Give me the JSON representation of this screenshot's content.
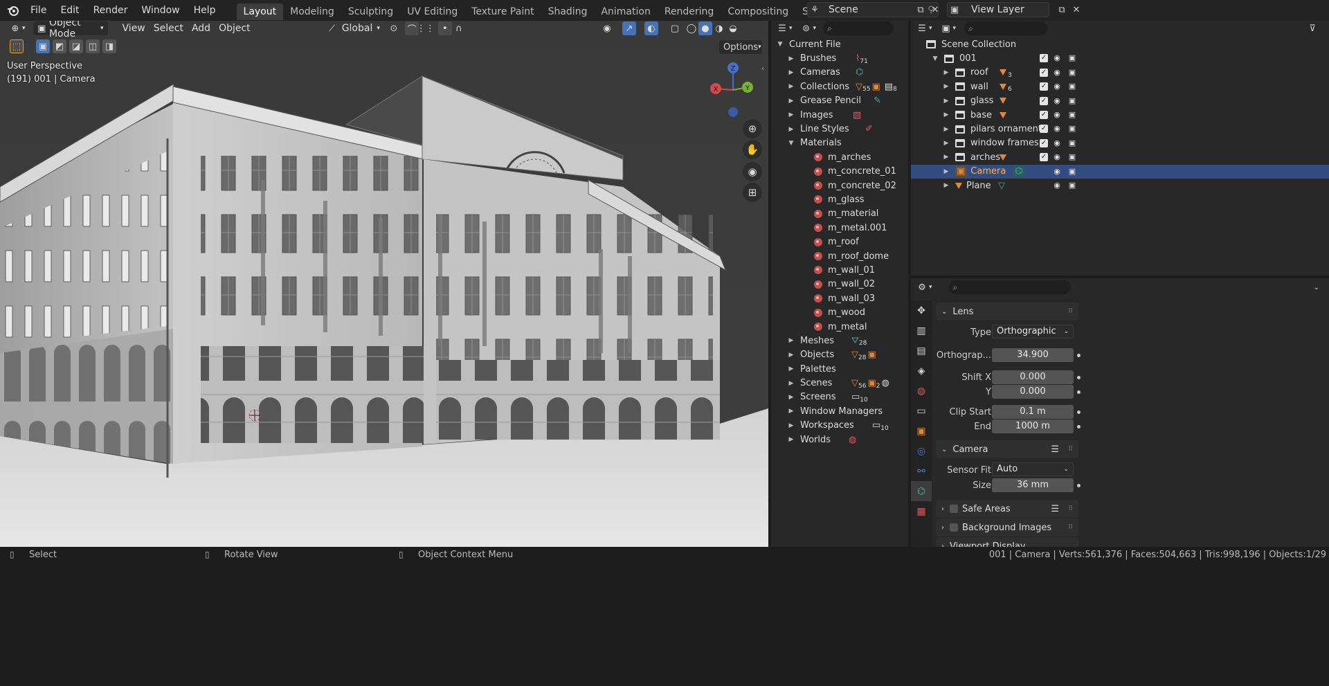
{
  "topbar": {
    "menus": [
      "File",
      "Edit",
      "Render",
      "Window",
      "Help"
    ],
    "workspaces": [
      "Layout",
      "Modeling",
      "Sculpting",
      "UV Editing",
      "Texture Paint",
      "Shading",
      "Animation",
      "Rendering",
      "Compositing",
      "Scripting"
    ],
    "active_workspace": "Layout",
    "scene_name": "Scene",
    "view_layer": "View Layer"
  },
  "viewport": {
    "mode": "Object Mode",
    "menus": [
      "View",
      "Select",
      "Add",
      "Object"
    ],
    "orientation": "Global",
    "options_label": "Options",
    "overlay_title": "User Perspective",
    "overlay_subtitle": "(191) 001 | Camera",
    "gizmo": {
      "z": "Z",
      "y": "Y",
      "x": "X"
    }
  },
  "data_outliner": {
    "root": "Current File",
    "items": [
      {
        "label": "Brushes",
        "count": "71"
      },
      {
        "label": "Cameras",
        "count": ""
      },
      {
        "label": "Collections",
        "count": "55",
        "count2": "8"
      },
      {
        "label": "Grease Pencil",
        "count": ""
      },
      {
        "label": "Images",
        "count": ""
      },
      {
        "label": "Line Styles",
        "count": ""
      },
      {
        "label": "Materials",
        "count": ""
      }
    ],
    "materials": [
      "m_arches",
      "m_concrete_01",
      "m_concrete_02",
      "m_glass",
      "m_material",
      "m_metal.001",
      "m_roof",
      "m_roof_dome",
      "m_wall_01",
      "m_wall_02",
      "m_wall_03",
      "m_wood",
      "m_metal"
    ],
    "items_after": [
      {
        "label": "Meshes",
        "count": "28"
      },
      {
        "label": "Objects",
        "count": "28"
      },
      {
        "label": "Palettes",
        "count": ""
      },
      {
        "label": "Scenes",
        "count": "56",
        "count2": "2"
      },
      {
        "label": "Screens",
        "count": "10"
      },
      {
        "label": "Window Managers",
        "count": ""
      },
      {
        "label": "Workspaces",
        "count": "10"
      },
      {
        "label": "Worlds",
        "count": ""
      }
    ]
  },
  "scene_outliner": {
    "root": "Scene Collection",
    "collection": "001",
    "children": [
      {
        "label": "roof",
        "count": "3"
      },
      {
        "label": "wall",
        "count": "6"
      },
      {
        "label": "glass",
        "count": ""
      },
      {
        "label": "base",
        "count": ""
      },
      {
        "label": "pilars ornaments",
        "count": ""
      },
      {
        "label": "window frames",
        "count": ""
      },
      {
        "label": "arches",
        "count": ""
      }
    ],
    "camera": "Camera",
    "plane": "Plane"
  },
  "properties": {
    "lens_section": "Lens",
    "type_label": "Type",
    "type_value": "Orthographic",
    "ortho_label": "Orthograp...",
    "ortho_value": "34.900",
    "shiftx_label": "Shift X",
    "shiftx_value": "0.000",
    "shifty_label": "Y",
    "shifty_value": "0.000",
    "clipstart_label": "Clip Start",
    "clipstart_value": "0.1 m",
    "clipend_label": "End",
    "clipend_value": "1000 m",
    "camera_section": "Camera",
    "sensorfit_label": "Sensor Fit",
    "sensorfit_value": "Auto",
    "size_label": "Size",
    "size_value": "36 mm",
    "safe_areas": "Safe Areas",
    "background_images": "Background Images",
    "viewport_display": "Viewport Display"
  },
  "statusbar": {
    "select": "Select",
    "rotate": "Rotate View",
    "context": "Object Context Menu",
    "stats": "001 | Camera | Verts:561,376 | Faces:504,663 | Tris:998,196 | Objects:1/29"
  },
  "colors": {
    "accent_blue": "#334d80",
    "object_orange": "#e0893a",
    "camera_teal": "#4fa39a",
    "material_red": "#c25050"
  }
}
